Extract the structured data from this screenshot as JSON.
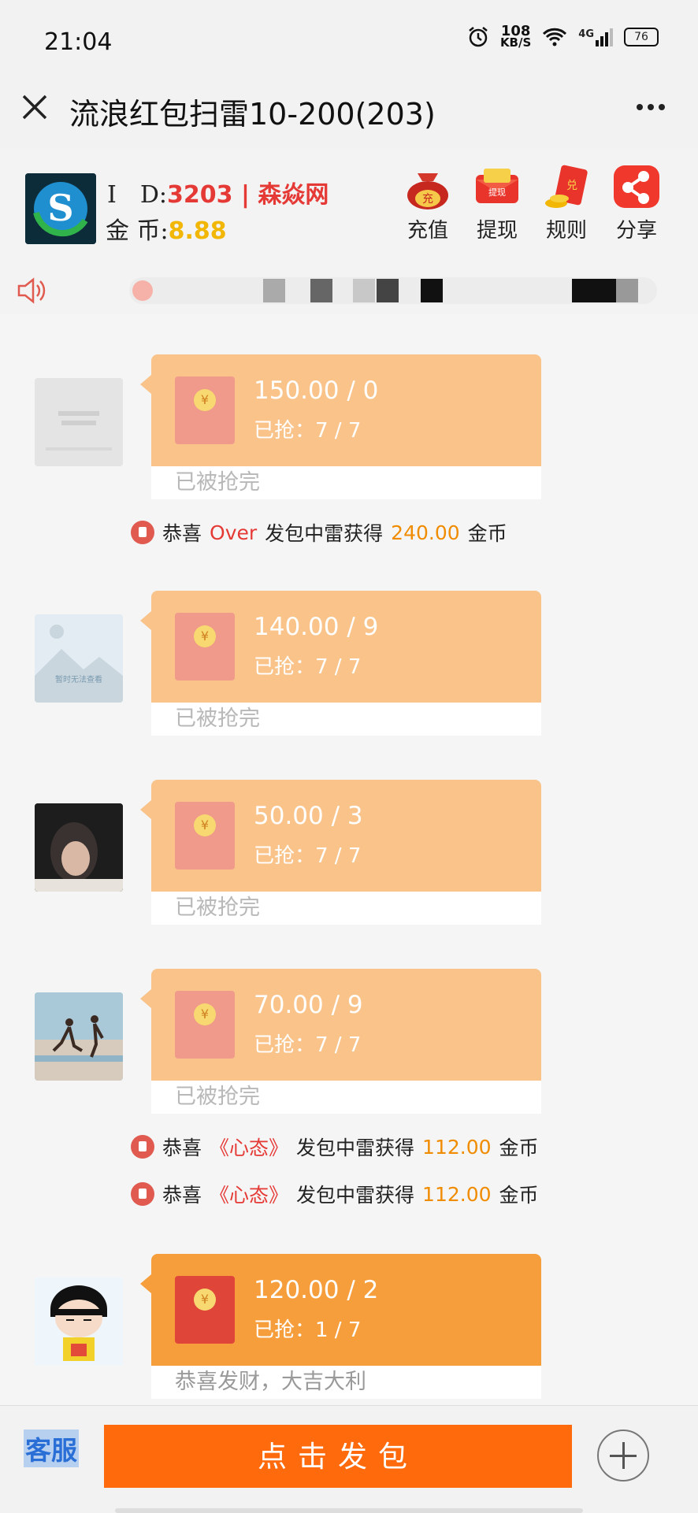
{
  "status": {
    "time": "21:04",
    "net_speed": "108",
    "net_unit": "KB/S",
    "signal": "4G",
    "battery": "76"
  },
  "titlebar": {
    "title": "流浪红包扫雷10-200(203)"
  },
  "profile": {
    "id_label": "I　D:",
    "id_value": "3203 | 森焱网",
    "coin_label": "金 币:",
    "coin_value": "8.88"
  },
  "actions": [
    {
      "label": "充值",
      "icon": "money-bag-icon"
    },
    {
      "label": "提现",
      "icon": "red-envelope-icon"
    },
    {
      "label": "规则",
      "icon": "rules-envelope-icon"
    },
    {
      "label": "分享",
      "icon": "share-icon"
    }
  ],
  "messages": [
    {
      "avatar": "blurred-avatar",
      "amount": "150.00 / 0",
      "grabbed": "已抢：7 / 7",
      "footer": "已被抢完",
      "state": "done"
    },
    {
      "avatar": "image-unavailable-avatar",
      "amount": "140.00 / 9",
      "grabbed": "已抢：7 / 7",
      "footer": "已被抢完",
      "state": "done"
    },
    {
      "avatar": "person-avatar",
      "amount": "50.00 / 3",
      "grabbed": "已抢：7 / 7",
      "footer": "已被抢完",
      "state": "done"
    },
    {
      "avatar": "beach-avatar",
      "amount": "70.00 / 9",
      "grabbed": "已抢：7 / 7",
      "footer": "已被抢完",
      "state": "done"
    },
    {
      "avatar": "cartoon-avatar",
      "amount": "120.00 / 2",
      "grabbed": "已抢：1 / 7",
      "footer": "恭喜发财，大吉大利",
      "state": "active"
    }
  ],
  "system": [
    {
      "prefix": "恭喜",
      "who": "Over",
      "mid": "发包中雷获得",
      "amount": "240.00",
      "unit": "金币"
    },
    {
      "prefix": "恭喜",
      "who": "《心态》",
      "mid": "发包中雷获得",
      "amount": "112.00",
      "unit": "金币"
    },
    {
      "prefix": "恭喜",
      "who": "《心态》",
      "mid": "发包中雷获得",
      "amount": "112.00",
      "unit": "金币"
    }
  ],
  "bottom": {
    "service": "客服",
    "send": "点击发包"
  },
  "colors": {
    "packet_done": "#f9c38a",
    "packet_active": "#f79e3c",
    "send_button": "#ff6a0d",
    "id_red": "#e53935",
    "coin_gold": "#f2b705"
  }
}
